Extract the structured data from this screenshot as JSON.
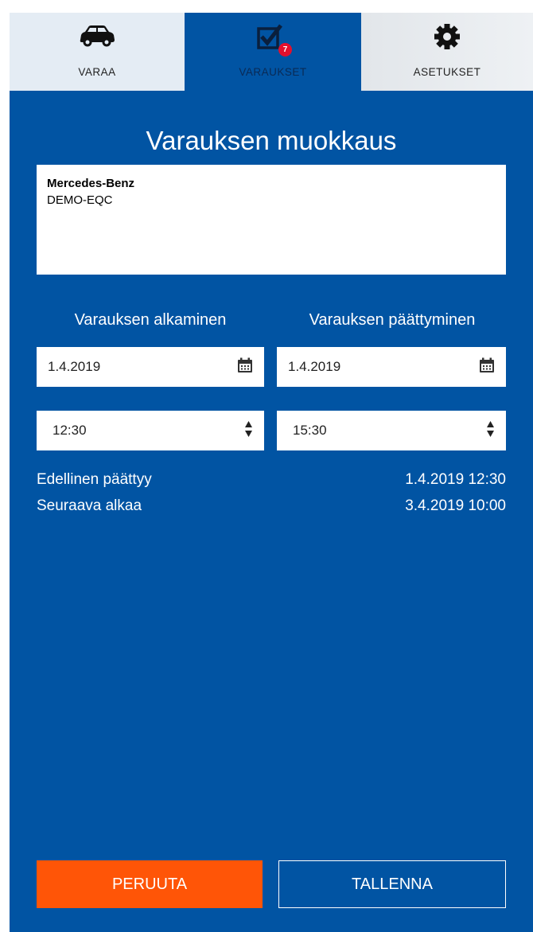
{
  "tabs": [
    {
      "label": "VARAA",
      "icon": "car-icon",
      "active": false
    },
    {
      "label": "VARAUKSET",
      "icon": "checkbox-icon",
      "active": true,
      "badge": "7"
    },
    {
      "label": "ASETUKSET",
      "icon": "gear-icon",
      "active": false
    }
  ],
  "form": {
    "title": "Varauksen muokkaus",
    "vehicle": {
      "make": "Mercedes-Benz",
      "model": "DEMO-EQC"
    },
    "start": {
      "label": "Varauksen alkaminen",
      "date": "1.4.2019",
      "time": "12:30"
    },
    "end": {
      "label": "Varauksen päättyminen",
      "date": "1.4.2019",
      "time": "15:30"
    },
    "previous": {
      "label": "Edellinen päättyy",
      "value": "1.4.2019 12:30"
    },
    "next": {
      "label": "Seuraava alkaa",
      "value": "3.4.2019 10:00"
    }
  },
  "buttons": {
    "cancel": "PERUUTA",
    "save": "TALLENNA"
  },
  "colors": {
    "panel": "#0154a3",
    "cancel": "#ff5507",
    "badge": "#e3102d"
  }
}
